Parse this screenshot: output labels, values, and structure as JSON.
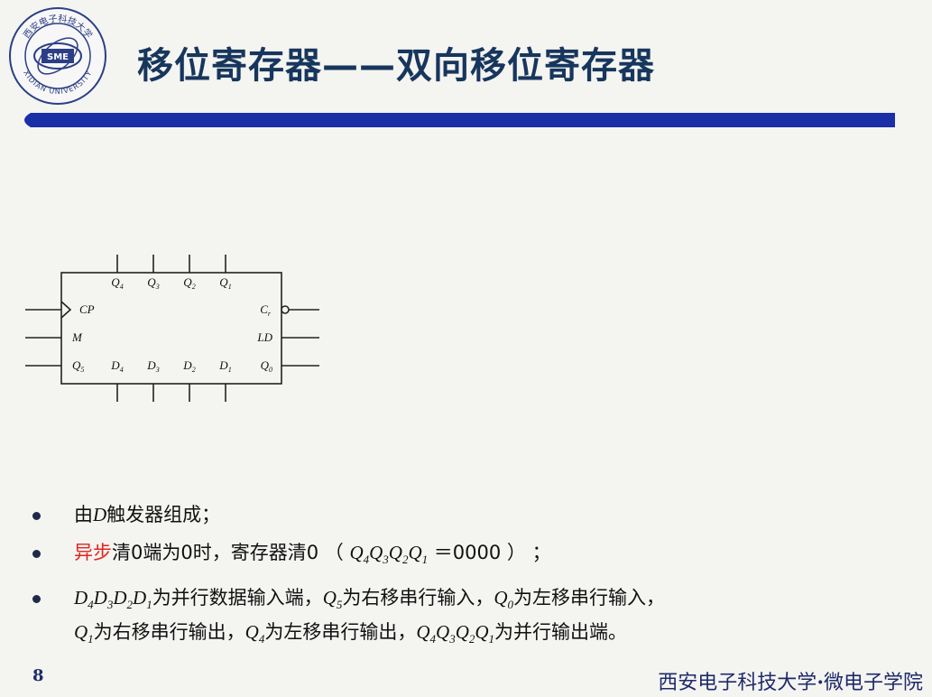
{
  "header": {
    "title": "移位寄存器——双向移位寄存器",
    "logo": {
      "top_text": "西安电子科技大学",
      "center_text": "SME",
      "bottom_text": "XIDIAN UNIVERSITY"
    }
  },
  "diagram": {
    "top_outputs": [
      "Q4",
      "Q3",
      "Q2",
      "Q1"
    ],
    "left_inputs": [
      "CP",
      "M",
      "Q5"
    ],
    "right_pins": [
      "Cr",
      "LD",
      "Q0"
    ],
    "bottom_inputs": [
      "D4",
      "D3",
      "D2",
      "D1"
    ]
  },
  "bullets": [
    {
      "pre": "由",
      "var": "D",
      "post": "触发器组成；"
    },
    {
      "red": "异步",
      "post1": "清0端为0时，寄存器清0 （ ",
      "vars": "Q4Q3Q2Q1",
      "post2": " ＝0000 ） ；"
    },
    {
      "line1_vars": "D4D3D2D1",
      "line1_a": "为并行数据输入端，",
      "line1_v2": "Q5",
      "line1_b": "为右移串行输入，",
      "line1_v3": "Q0",
      "line1_c": "为左移串行输入，",
      "line2_v1": "Q1",
      "line2_a": "为右移串行输出，",
      "line2_v2": "Q4",
      "line2_b": "为左移串行输出，",
      "line2_v3": "Q4Q3Q2Q1",
      "line2_c": "为并行输出端。"
    }
  ],
  "footer": {
    "page_number": "8",
    "university": "西安电子科技大学",
    "separator": "·",
    "school": "微电子学院"
  },
  "colors": {
    "title": "#17365d",
    "bar": "#1b2fa6",
    "highlight": "#e0261e",
    "footer": "#1f2a6a"
  }
}
